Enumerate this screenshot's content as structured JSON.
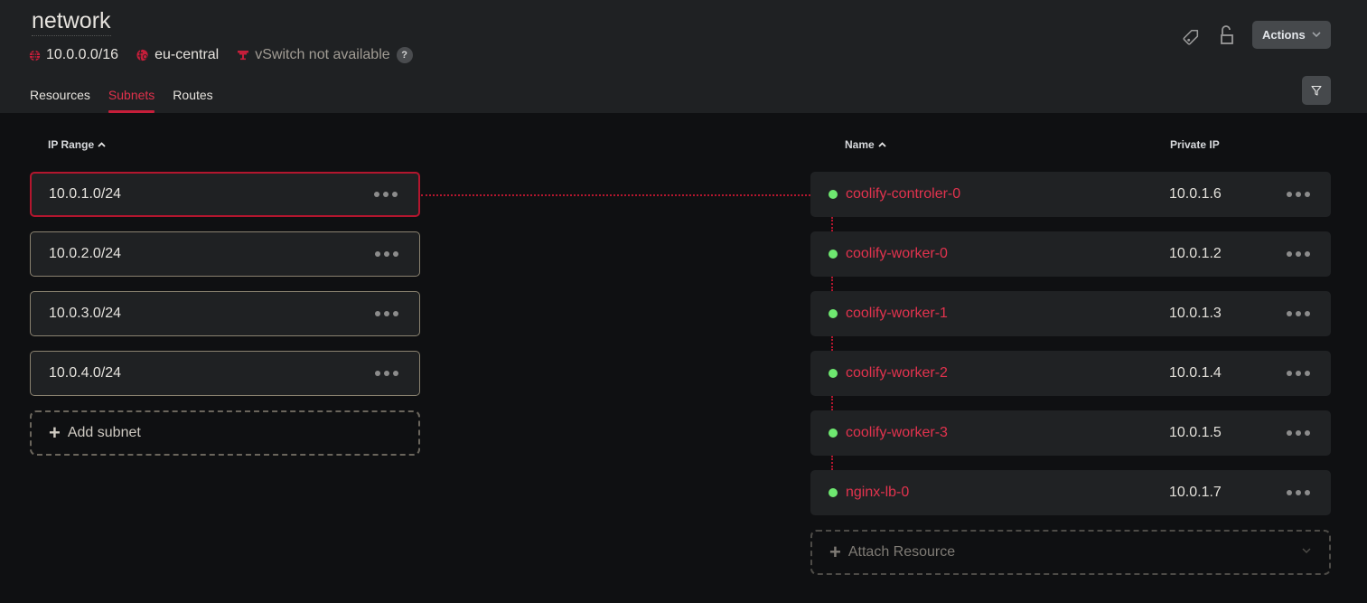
{
  "header": {
    "title": "network",
    "ip_range": "10.0.0.0/16",
    "location": "eu-central",
    "vswitch": "vSwitch not available",
    "help_label": "?",
    "actions_label": "Actions",
    "icons": {
      "labels": "tag-icon",
      "protection": "unlock-icon",
      "actions_chevron": "chevron-down-icon",
      "filter": "filter-icon"
    }
  },
  "tabs": [
    {
      "label": "Resources",
      "active": false
    },
    {
      "label": "Subnets",
      "active": true
    },
    {
      "label": "Routes",
      "active": false
    }
  ],
  "subnets": {
    "column_header": "IP Range",
    "sort": "ascending",
    "items": [
      {
        "ip_range": "10.0.1.0/24",
        "selected": true
      },
      {
        "ip_range": "10.0.2.0/24",
        "selected": false
      },
      {
        "ip_range": "10.0.3.0/24",
        "selected": false
      },
      {
        "ip_range": "10.0.4.0/24",
        "selected": false
      }
    ],
    "add_label": "Add subnet"
  },
  "resources": {
    "columns": {
      "name": "Name",
      "private_ip": "Private IP"
    },
    "sort": "ascending",
    "items": [
      {
        "name": "coolify-controler-0",
        "private_ip": "10.0.1.6",
        "status": "running"
      },
      {
        "name": "coolify-worker-0",
        "private_ip": "10.0.1.2",
        "status": "running"
      },
      {
        "name": "coolify-worker-1",
        "private_ip": "10.0.1.3",
        "status": "running"
      },
      {
        "name": "coolify-worker-2",
        "private_ip": "10.0.1.4",
        "status": "running"
      },
      {
        "name": "coolify-worker-3",
        "private_ip": "10.0.1.5",
        "status": "running"
      },
      {
        "name": "nginx-lb-0",
        "private_ip": "10.0.1.7",
        "status": "running"
      }
    ],
    "attach_label": "Attach Resource"
  },
  "colors": {
    "accent": "#e0314b",
    "accent_dark": "#b3162e",
    "status_running": "#6ee870",
    "header_bg": "#1f2123",
    "page_bg": "#0f1012"
  }
}
